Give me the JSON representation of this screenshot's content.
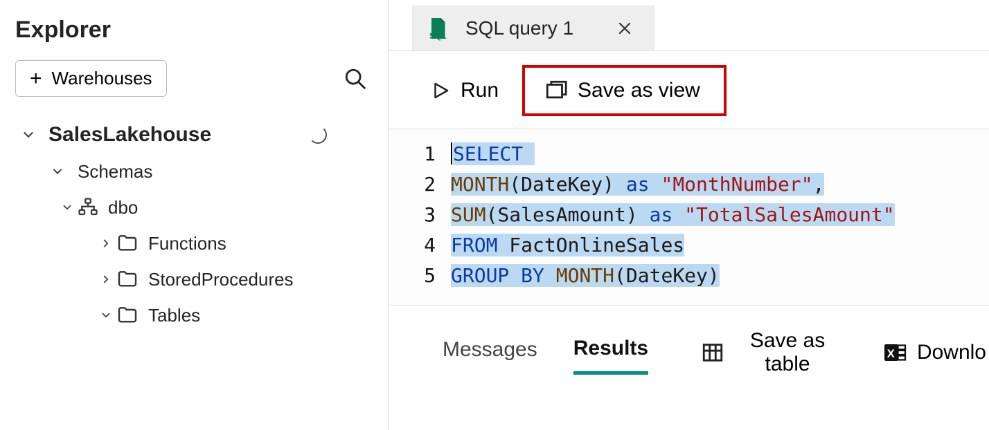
{
  "explorer": {
    "title": "Explorer",
    "warehouses_btn": "Warehouses",
    "tree": {
      "lakehouse": "SalesLakehouse",
      "schemas_label": "Schemas",
      "dbo_label": "dbo",
      "functions_label": "Functions",
      "sp_label": "StoredProcedures",
      "tables_label": "Tables"
    }
  },
  "tab": {
    "label": "SQL query 1"
  },
  "toolbar": {
    "run": "Run",
    "save_view": "Save as view"
  },
  "editor": {
    "line_numbers": [
      "1",
      "2",
      "3",
      "4",
      "5"
    ],
    "tokens": {
      "l1_select": "SELECT",
      "l2_month": "MONTH",
      "l2_paren1": "(",
      "l2_datekey": "DateKey",
      "l2_paren2": ") ",
      "l2_as": "as",
      "l2_sp": " ",
      "l2_str": "\"MonthNumber\"",
      "l2_comma": ",",
      "l3_sum": "SUM",
      "l3_paren1": "(",
      "l3_salesamt": "SalesAmount",
      "l3_paren2": ") ",
      "l3_as": "as",
      "l3_sp": " ",
      "l3_str": "\"TotalSalesAmount\"",
      "l4_from": "FROM",
      "l4_sp": " ",
      "l4_tbl": "FactOnlineSales",
      "l5_group": "GROUP",
      "l5_sp1": " ",
      "l5_by": "BY",
      "l5_sp2": " ",
      "l5_month": "MONTH",
      "l5_paren1": "(",
      "l5_datekey": "DateKey",
      "l5_paren2": ")"
    }
  },
  "bottom": {
    "messages": "Messages",
    "results": "Results",
    "save_table": "Save as table",
    "download": "Downlo"
  }
}
